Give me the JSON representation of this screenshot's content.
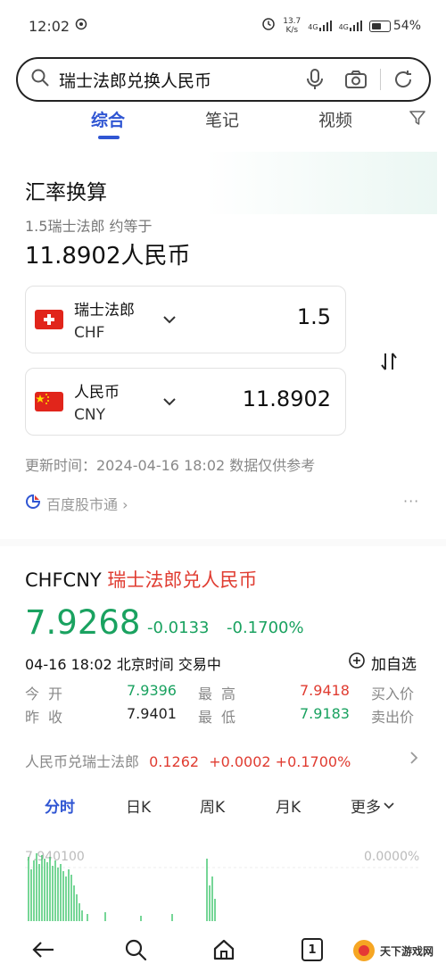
{
  "status_bar": {
    "time": "12:02",
    "net_speed_value": "13.7",
    "net_speed_unit": "K/s",
    "signal1": "4G",
    "signal2": "4G",
    "battery": "54%"
  },
  "search": {
    "query": "瑞士法郎兑换人民币"
  },
  "tabs": [
    "综合",
    "笔记",
    "视频"
  ],
  "converter": {
    "title": "汇率换算",
    "subtitle": "1.5瑞士法郎 约等于",
    "result": "11.8902人民币",
    "from": {
      "name": "瑞士法郎",
      "code": "CHF",
      "amount": "1.5"
    },
    "to": {
      "name": "人民币",
      "code": "CNY",
      "amount": "11.8902"
    },
    "updated": "更新时间：2024-04-16 18:02 数据仅供参考",
    "source": "百度股市通 ›",
    "more": "···"
  },
  "stock": {
    "code": "CHFCNY",
    "name": "瑞士法郎兑人民币",
    "price": "7.9268",
    "change": "-0.0133",
    "change_pct": "-0.1700%",
    "time_info": "04-16 18:02  北京时间  交易中",
    "watch_label": "加自选",
    "quotes": {
      "open_label": "今开",
      "open_value": "7.9396",
      "high_label": "最高",
      "high_value": "7.9418",
      "buy_label": "买入价",
      "prev_label": "昨收",
      "prev_value": "7.9401",
      "low_label": "最低",
      "low_value": "7.9183",
      "sell_label": "卖出价"
    },
    "reverse": {
      "label": "人民币兑瑞士法郎",
      "value": "0.1262",
      "change": "+0.0002",
      "pct": "+0.1700%"
    },
    "periods": [
      "分时",
      "日K",
      "周K",
      "月K",
      "更多"
    ],
    "chart_left_label": "7.940100",
    "chart_right_label": "0.0000%"
  },
  "watermark": {
    "text": "天下游戏网"
  },
  "colors": {
    "accent": "#3056d3",
    "up": "#e03c31",
    "down": "#1aa260"
  }
}
